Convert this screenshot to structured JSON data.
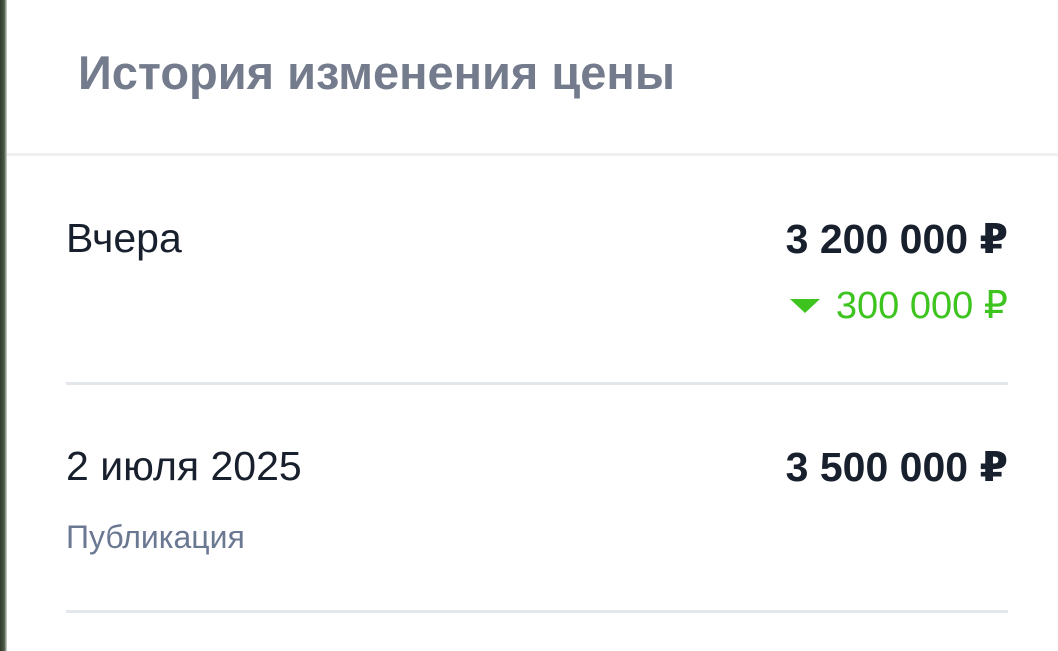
{
  "panel": {
    "title": "История изменения цены"
  },
  "history": [
    {
      "date": "Вчера",
      "price": "3 200 000 ₽",
      "change": "300 000 ₽",
      "change_direction": "down",
      "change_color": "#3ec41f"
    },
    {
      "date": "2 июля 2025",
      "price": "3 500 000 ₽",
      "note": "Публикация"
    }
  ],
  "icons": {
    "price_drop": "triangle-down-icon"
  }
}
